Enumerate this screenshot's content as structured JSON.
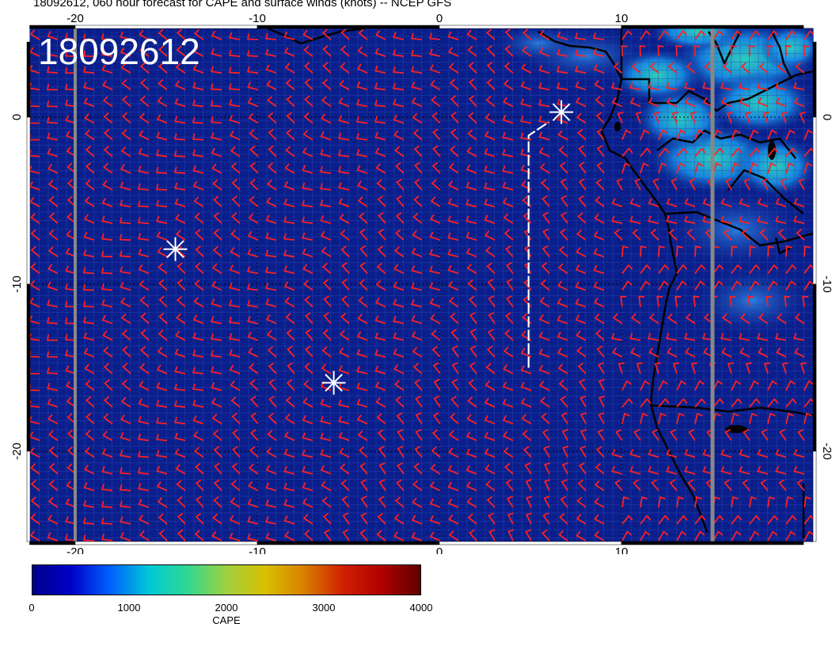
{
  "title": "18092612, 060 hour forecast for CAPE and surface winds (knots) -- NCEP GFS",
  "stamp": "18092612",
  "map": {
    "lon_range": [
      -22.5,
      20.0
    ],
    "lat_range": [
      -25.5,
      4.5
    ],
    "ocean_color": "#0a1f8c",
    "barb_color": "#ff2020",
    "coast_color": "#000000",
    "x_ticks": [
      "-20",
      "-10",
      "0",
      "10"
    ],
    "y_ticks": [
      "0",
      "-10",
      "-20"
    ],
    "markers": [
      {
        "name": "marker-a",
        "lon": 6.7,
        "lat": 0.3
      },
      {
        "name": "marker-b",
        "lon": -14.5,
        "lat": -7.9
      },
      {
        "name": "marker-c",
        "lon": -5.8,
        "lat": -15.9
      }
    ],
    "track": [
      [
        4.9,
        -15.0
      ],
      [
        4.9,
        -1.1
      ],
      [
        6.0,
        -0.3
      ]
    ]
  },
  "colorbar": {
    "label": "CAPE",
    "ticks": [
      "0",
      "1000",
      "2000",
      "3000",
      "4000"
    ],
    "colors": [
      "#00008a",
      "#0000c8",
      "#0060ff",
      "#00c8d8",
      "#30d890",
      "#a0d040",
      "#d8c000",
      "#d88000",
      "#d02000",
      "#b00000",
      "#600000"
    ]
  }
}
